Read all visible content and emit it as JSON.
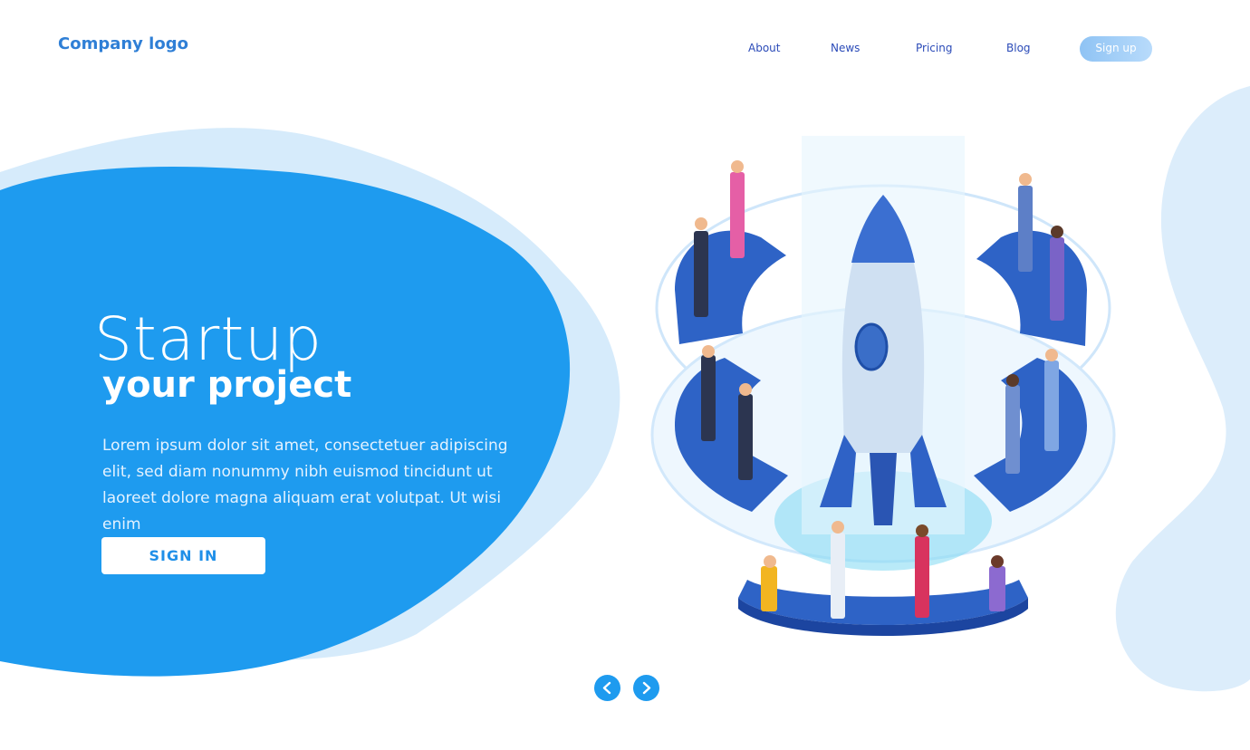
{
  "header": {
    "logo": "Company logo",
    "nav": {
      "about": "About",
      "news": "News",
      "pricing": "Pricing",
      "blog": "Blog"
    },
    "signup_label": "Sign up"
  },
  "hero": {
    "title": "Startup",
    "subtitle": "your project",
    "body": "Lorem ipsum dolor sit amet, consectetuer adipiscing elit, sed diam nonummy nibh euismod tincidunt ut laoreet dolore magna aliquam erat volutpat. Ut wisi enim",
    "cta_label": "SIGN IN"
  },
  "carousel": {
    "prev_icon": "chevron-left-icon",
    "next_icon": "chevron-right-icon"
  },
  "illustration": {
    "subject": "rocket-illustration"
  },
  "colors": {
    "accent": "#1e9bef",
    "blob_light": "#d6ebfb",
    "nav_text": "#2b4bb8"
  }
}
